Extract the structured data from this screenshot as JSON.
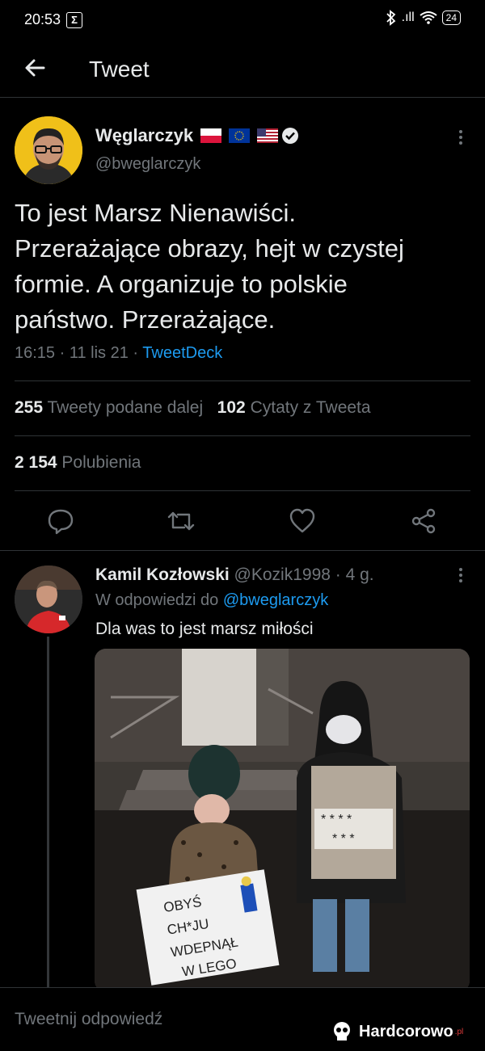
{
  "status_bar": {
    "time": "20:53",
    "sigma": "Σ",
    "signal": ".ıll",
    "battery": "24"
  },
  "header": {
    "title": "Tweet"
  },
  "tweet": {
    "author_name": "Węglarczyk",
    "author_handle": "@bweglarczyk",
    "flags": [
      "poland-flag",
      "eu-flag",
      "usa-flag"
    ],
    "text_lines": [
      "To jest Marsz Nienawiści.",
      "Przerażające obrazy, hejt w czystej",
      "formie. A organizuje to polskie",
      "państwo. Przerażające."
    ],
    "time": "16:15",
    "date": "11 lis 21",
    "sep": " · ",
    "client": "TweetDeck",
    "retweets_count": "255",
    "retweets_label": "Tweety podane dalej",
    "quotes_count": "102",
    "quotes_label": "Cytaty z Tweeta",
    "likes_count": "2 154",
    "likes_label": "Polubienia"
  },
  "actions": [
    "reply-icon",
    "retweet-icon",
    "like-icon",
    "share-icon"
  ],
  "reply": {
    "author_name": "Kamil Kozłowski",
    "author_handle": "@Kozik1998",
    "age": "· 4 g.",
    "in_reply_to_label": "W odpowiedzi do",
    "in_reply_to_handle": "@bweglarczyk",
    "text": "Dla was to jest marsz miłości",
    "sign_left": [
      "OBYŚ",
      "CH*JU",
      "WDEPNĄŁ",
      "W LEGO"
    ],
    "sign_right": [
      "* * * *",
      "* * *"
    ]
  },
  "compose": {
    "placeholder": "Tweetnij odpowiedź"
  },
  "watermark": {
    "brand": "Hardcorowo",
    "tld": ".pl"
  },
  "colors": {
    "accent": "#1d9bf0",
    "background": "#000000",
    "muted": "#71767b",
    "text": "#e7e9ea"
  }
}
